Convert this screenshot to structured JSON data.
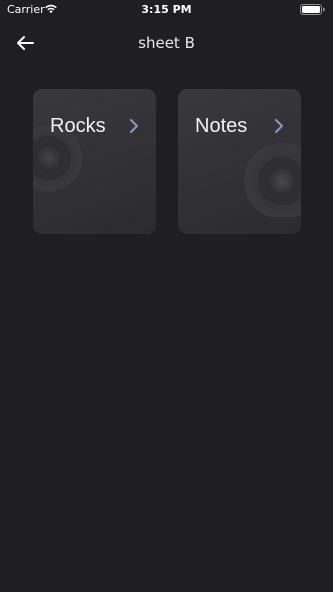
{
  "status_bar": {
    "carrier": "Carrier",
    "time": "3:15 PM",
    "wifi_icon": "wifi-icon",
    "battery_icon": "battery-icon"
  },
  "header": {
    "back_icon": "arrow-left-icon",
    "title": "sheet B"
  },
  "cards": [
    {
      "label": "Rocks",
      "icon": "chevron-right-icon"
    },
    {
      "label": "Notes",
      "icon": "chevron-right-icon"
    }
  ],
  "colors": {
    "background": "#1f1e20",
    "card": "#353438",
    "text": "#f2f2f4",
    "chevron": "#8a9bc4"
  }
}
